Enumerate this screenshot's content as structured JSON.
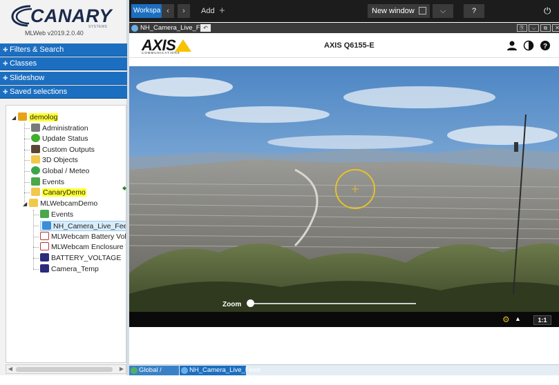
{
  "app": {
    "logo_text": "CANARY",
    "logo_sub": "SYSTEMS",
    "version": "MLWeb v2019.2.0.40"
  },
  "accordion": {
    "filters": "Filters & Search",
    "classes": "Classes",
    "slideshow": "Slideshow",
    "saved": "Saved selections"
  },
  "tree": {
    "root": "demolog",
    "items": {
      "administration": "Administration",
      "update_status": "Update Status",
      "custom_outputs": "Custom Outputs",
      "objects_3d": "3D Objects",
      "global_meteo": "Global / Meteo",
      "events": "Events",
      "canary_demo": "CanaryDemo",
      "mlwebcam_demo": "MLWebcamDemo",
      "cam_events": "Events",
      "nh_camera": "NH_Camera_Live_Feed",
      "battery_vol": "MLWebcam Battery Vol",
      "enclosure": "MLWebcam Enclosure T",
      "battery_voltage": "BATTERY_VOLTAGE",
      "camera_temp": "Camera_Temp"
    }
  },
  "toolbar": {
    "workspace": "Workspa",
    "add": "Add",
    "new_window": "New window",
    "help": "?"
  },
  "camera": {
    "window_title": "NH_Camera_Live_Feed",
    "brand": "AXIS",
    "brand_sub": "COMMUNICATIONS",
    "model": "AXIS Q6155-E",
    "zoom_label": "Zoom",
    "zoom_level": 0.0,
    "ratio_button": "1:1"
  },
  "taskbar": {
    "tab1": "Global / Meteo",
    "tab2": "NH_Camera_Live_Feed"
  },
  "colors": {
    "accent": "#1c6fc0",
    "highlight": "#ffff33",
    "toolbar": "#1c1c1c"
  }
}
